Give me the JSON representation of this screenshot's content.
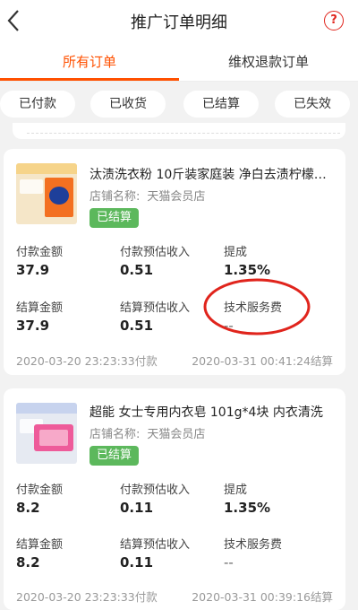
{
  "header": {
    "title": "推广订单明细",
    "help_label": "?"
  },
  "tabs": {
    "active": "所有订单",
    "other": "维权退款订单"
  },
  "filters": [
    "已付款",
    "已收货",
    "已结算",
    "已失效"
  ],
  "orders": [
    {
      "title": "汰渍洗衣粉 10斤装家庭装 净白去渍柠檬清...",
      "shop_label": "店铺名称:",
      "shop_name": "天猫会员店",
      "status": "已结算",
      "pay_amount_label": "付款金额",
      "pay_amount": "37.9",
      "pay_income_label": "付款预估收入",
      "pay_income": "0.51",
      "rate_label": "提成",
      "rate": "1.35%",
      "settle_amount_label": "结算金额",
      "settle_amount": "37.9",
      "settle_income_label": "结算预估收入",
      "settle_income": "0.51",
      "service_fee_label": "技术服务费",
      "service_fee": "--",
      "pay_time": "2020-03-20 23:23:33付款",
      "settle_time": "2020-03-31 00:41:24结算"
    },
    {
      "title": "超能 女士专用内衣皂 101g*4块 内衣清洗",
      "shop_label": "店铺名称:",
      "shop_name": "天猫会员店",
      "status": "已结算",
      "pay_amount_label": "付款金额",
      "pay_amount": "8.2",
      "pay_income_label": "付款预估收入",
      "pay_income": "0.11",
      "rate_label": "提成",
      "rate": "1.35%",
      "settle_amount_label": "结算金额",
      "settle_amount": "8.2",
      "settle_income_label": "结算预估收入",
      "settle_income": "0.11",
      "service_fee_label": "技术服务费",
      "service_fee": "--",
      "pay_time": "2020-03-20 23:23:33付款",
      "settle_time": "2020-03-31 00:39:16结算"
    }
  ],
  "colors": {
    "accent": "#ff5000",
    "status_green": "#5cb85c",
    "annotation_red": "#e0241c"
  }
}
